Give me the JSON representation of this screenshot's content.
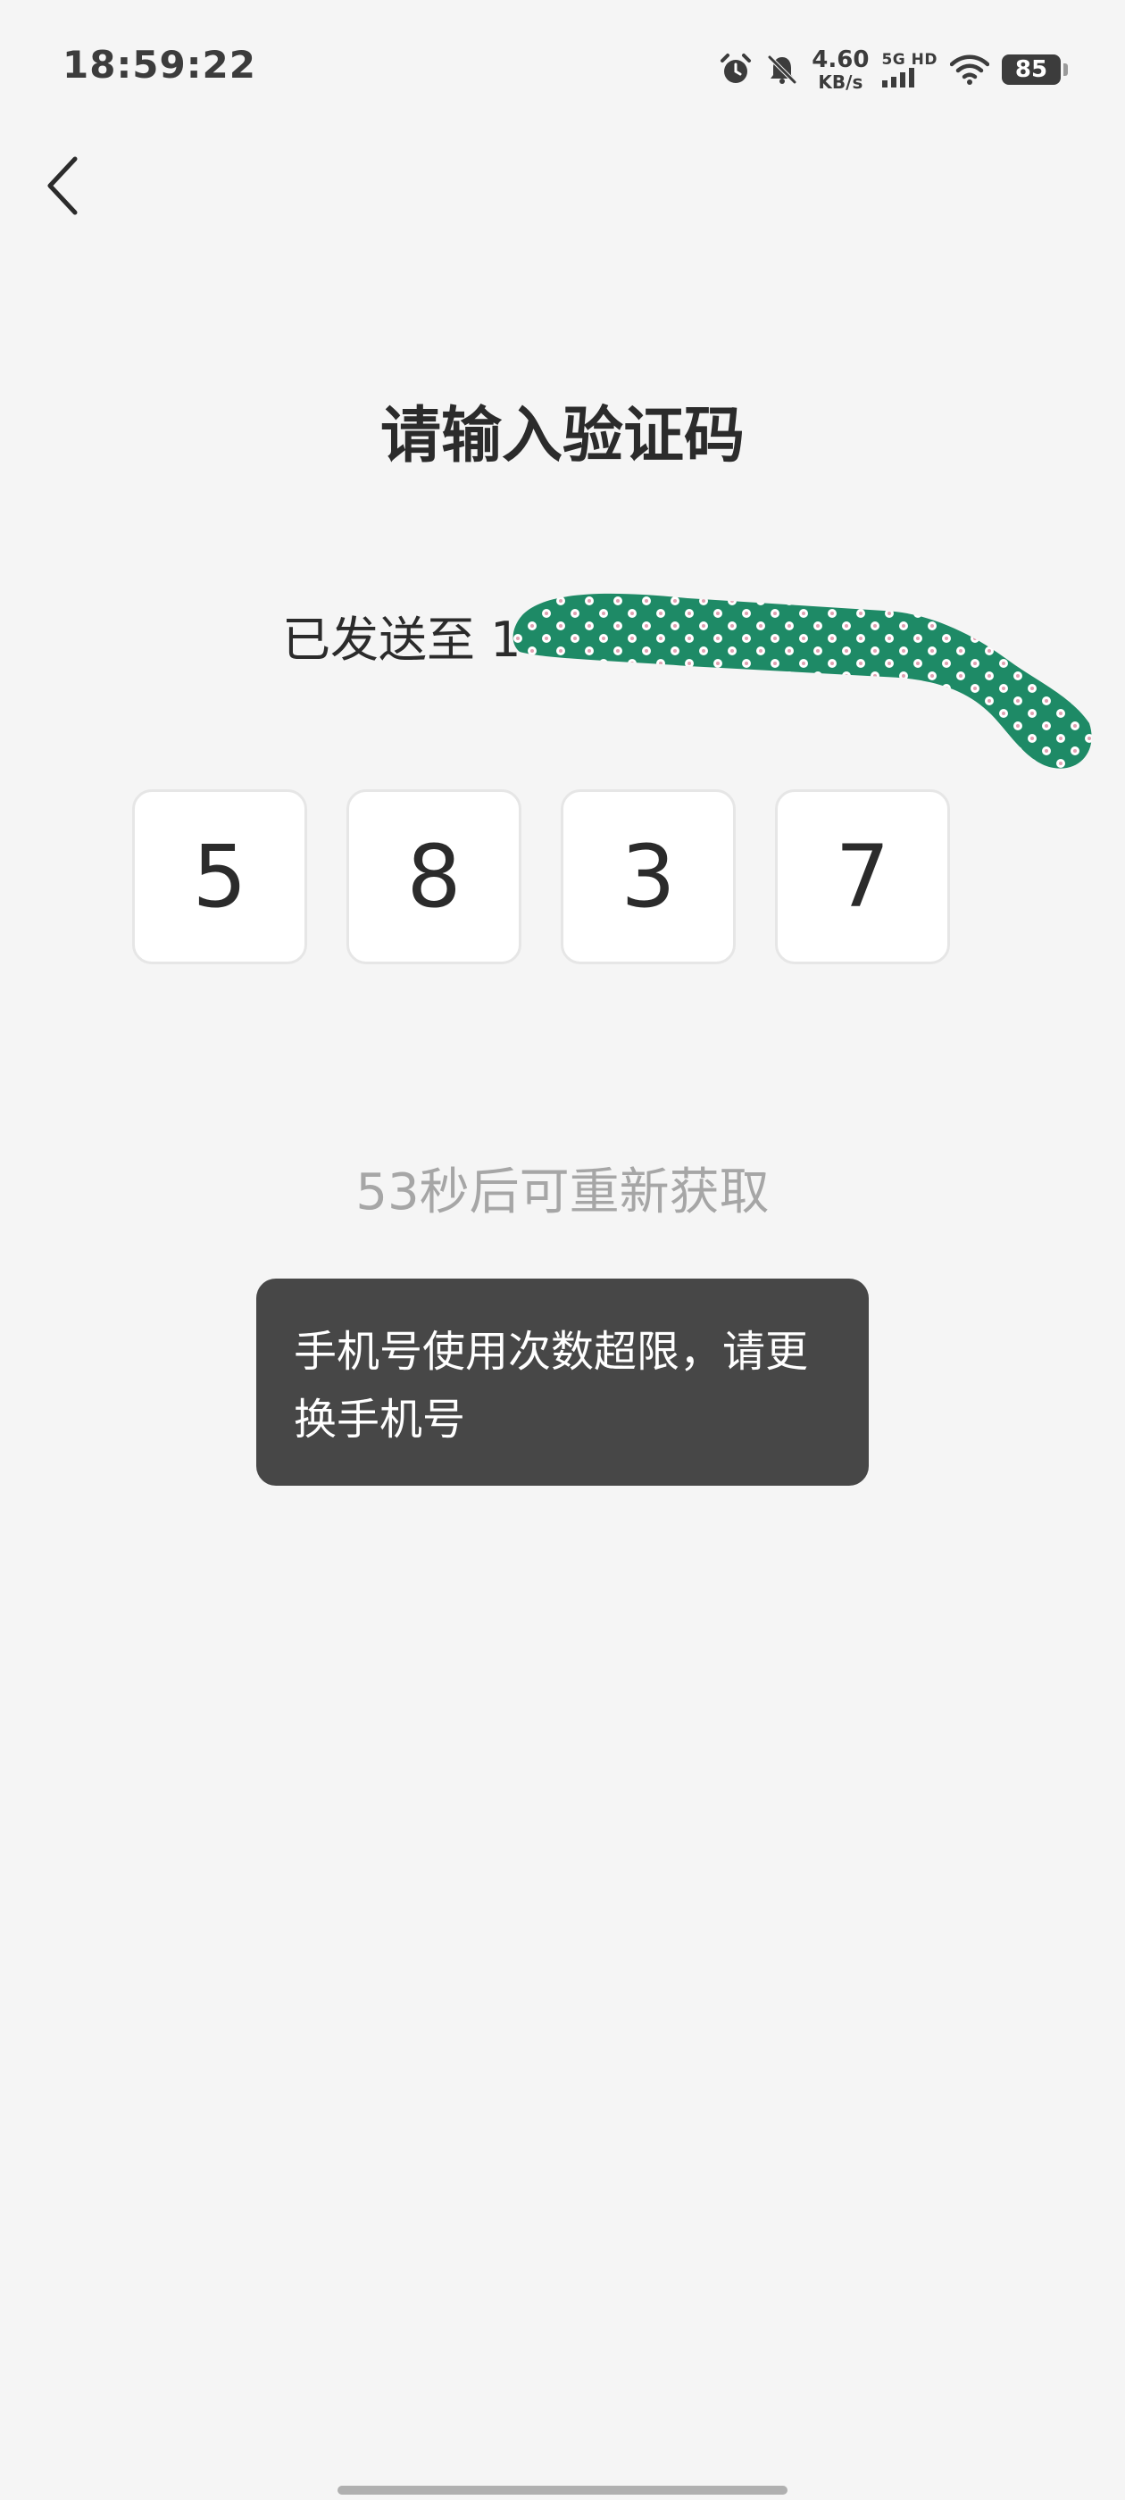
{
  "status_bar": {
    "time": "18:59:22",
    "net_speed_value": "4.60",
    "net_speed_unit": "KB/s",
    "network_type": "5G HD",
    "battery_level": "85",
    "icons": [
      "alarm-icon",
      "silent-bell-icon",
      "signal-icon",
      "wifi-icon",
      "battery-icon"
    ]
  },
  "header": {
    "back_icon": "chevron-left-icon"
  },
  "main": {
    "title": "请输入验证码",
    "sent_to_prefix": "已发送至 1",
    "code_digits": [
      "5",
      "8",
      "3",
      "7"
    ],
    "countdown": "53秒后可重新获取"
  },
  "toast": {
    "message": "手机号使用次数超限，请更换手机号"
  },
  "colors": {
    "background": "#f5f5f5",
    "toast_bg": "#474747",
    "countdown_text": "#a6a6a6",
    "redaction_green": "#1e8a66"
  }
}
